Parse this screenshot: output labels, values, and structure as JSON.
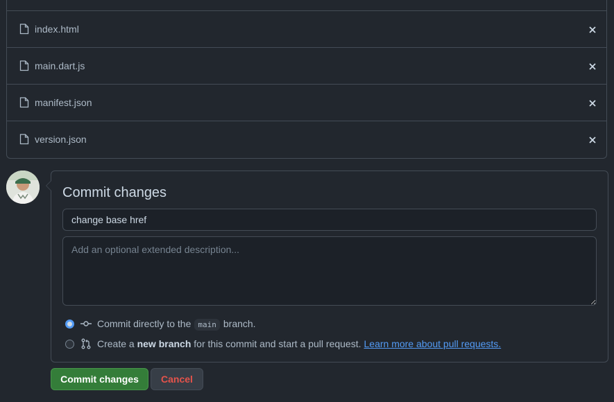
{
  "files": [
    {
      "name": "index.html"
    },
    {
      "name": "main.dart.js"
    },
    {
      "name": "manifest.json"
    },
    {
      "name": "version.json"
    }
  ],
  "icons": {
    "file": "file-icon",
    "remove": "x-icon",
    "commit": "git-commit-icon",
    "pull_request": "git-pull-request-icon"
  },
  "commit": {
    "title": "Commit changes",
    "summary_value": "change base href",
    "description_placeholder": "Add an optional extended description...",
    "option_direct": {
      "prefix": "Commit directly to the",
      "branch": "main",
      "suffix": "branch.",
      "selected": true
    },
    "option_new_branch": {
      "prefix": "Create a",
      "bold": "new branch",
      "suffix": "for this commit and start a pull request.",
      "link": "Learn more about pull requests.",
      "selected": false
    }
  },
  "buttons": {
    "commit_label": "Commit changes",
    "cancel_label": "Cancel"
  },
  "colors": {
    "background": "#22272e",
    "border": "#444c56",
    "primary_button": "#347d39",
    "danger_text": "#e5534b",
    "link": "#539bf5"
  }
}
